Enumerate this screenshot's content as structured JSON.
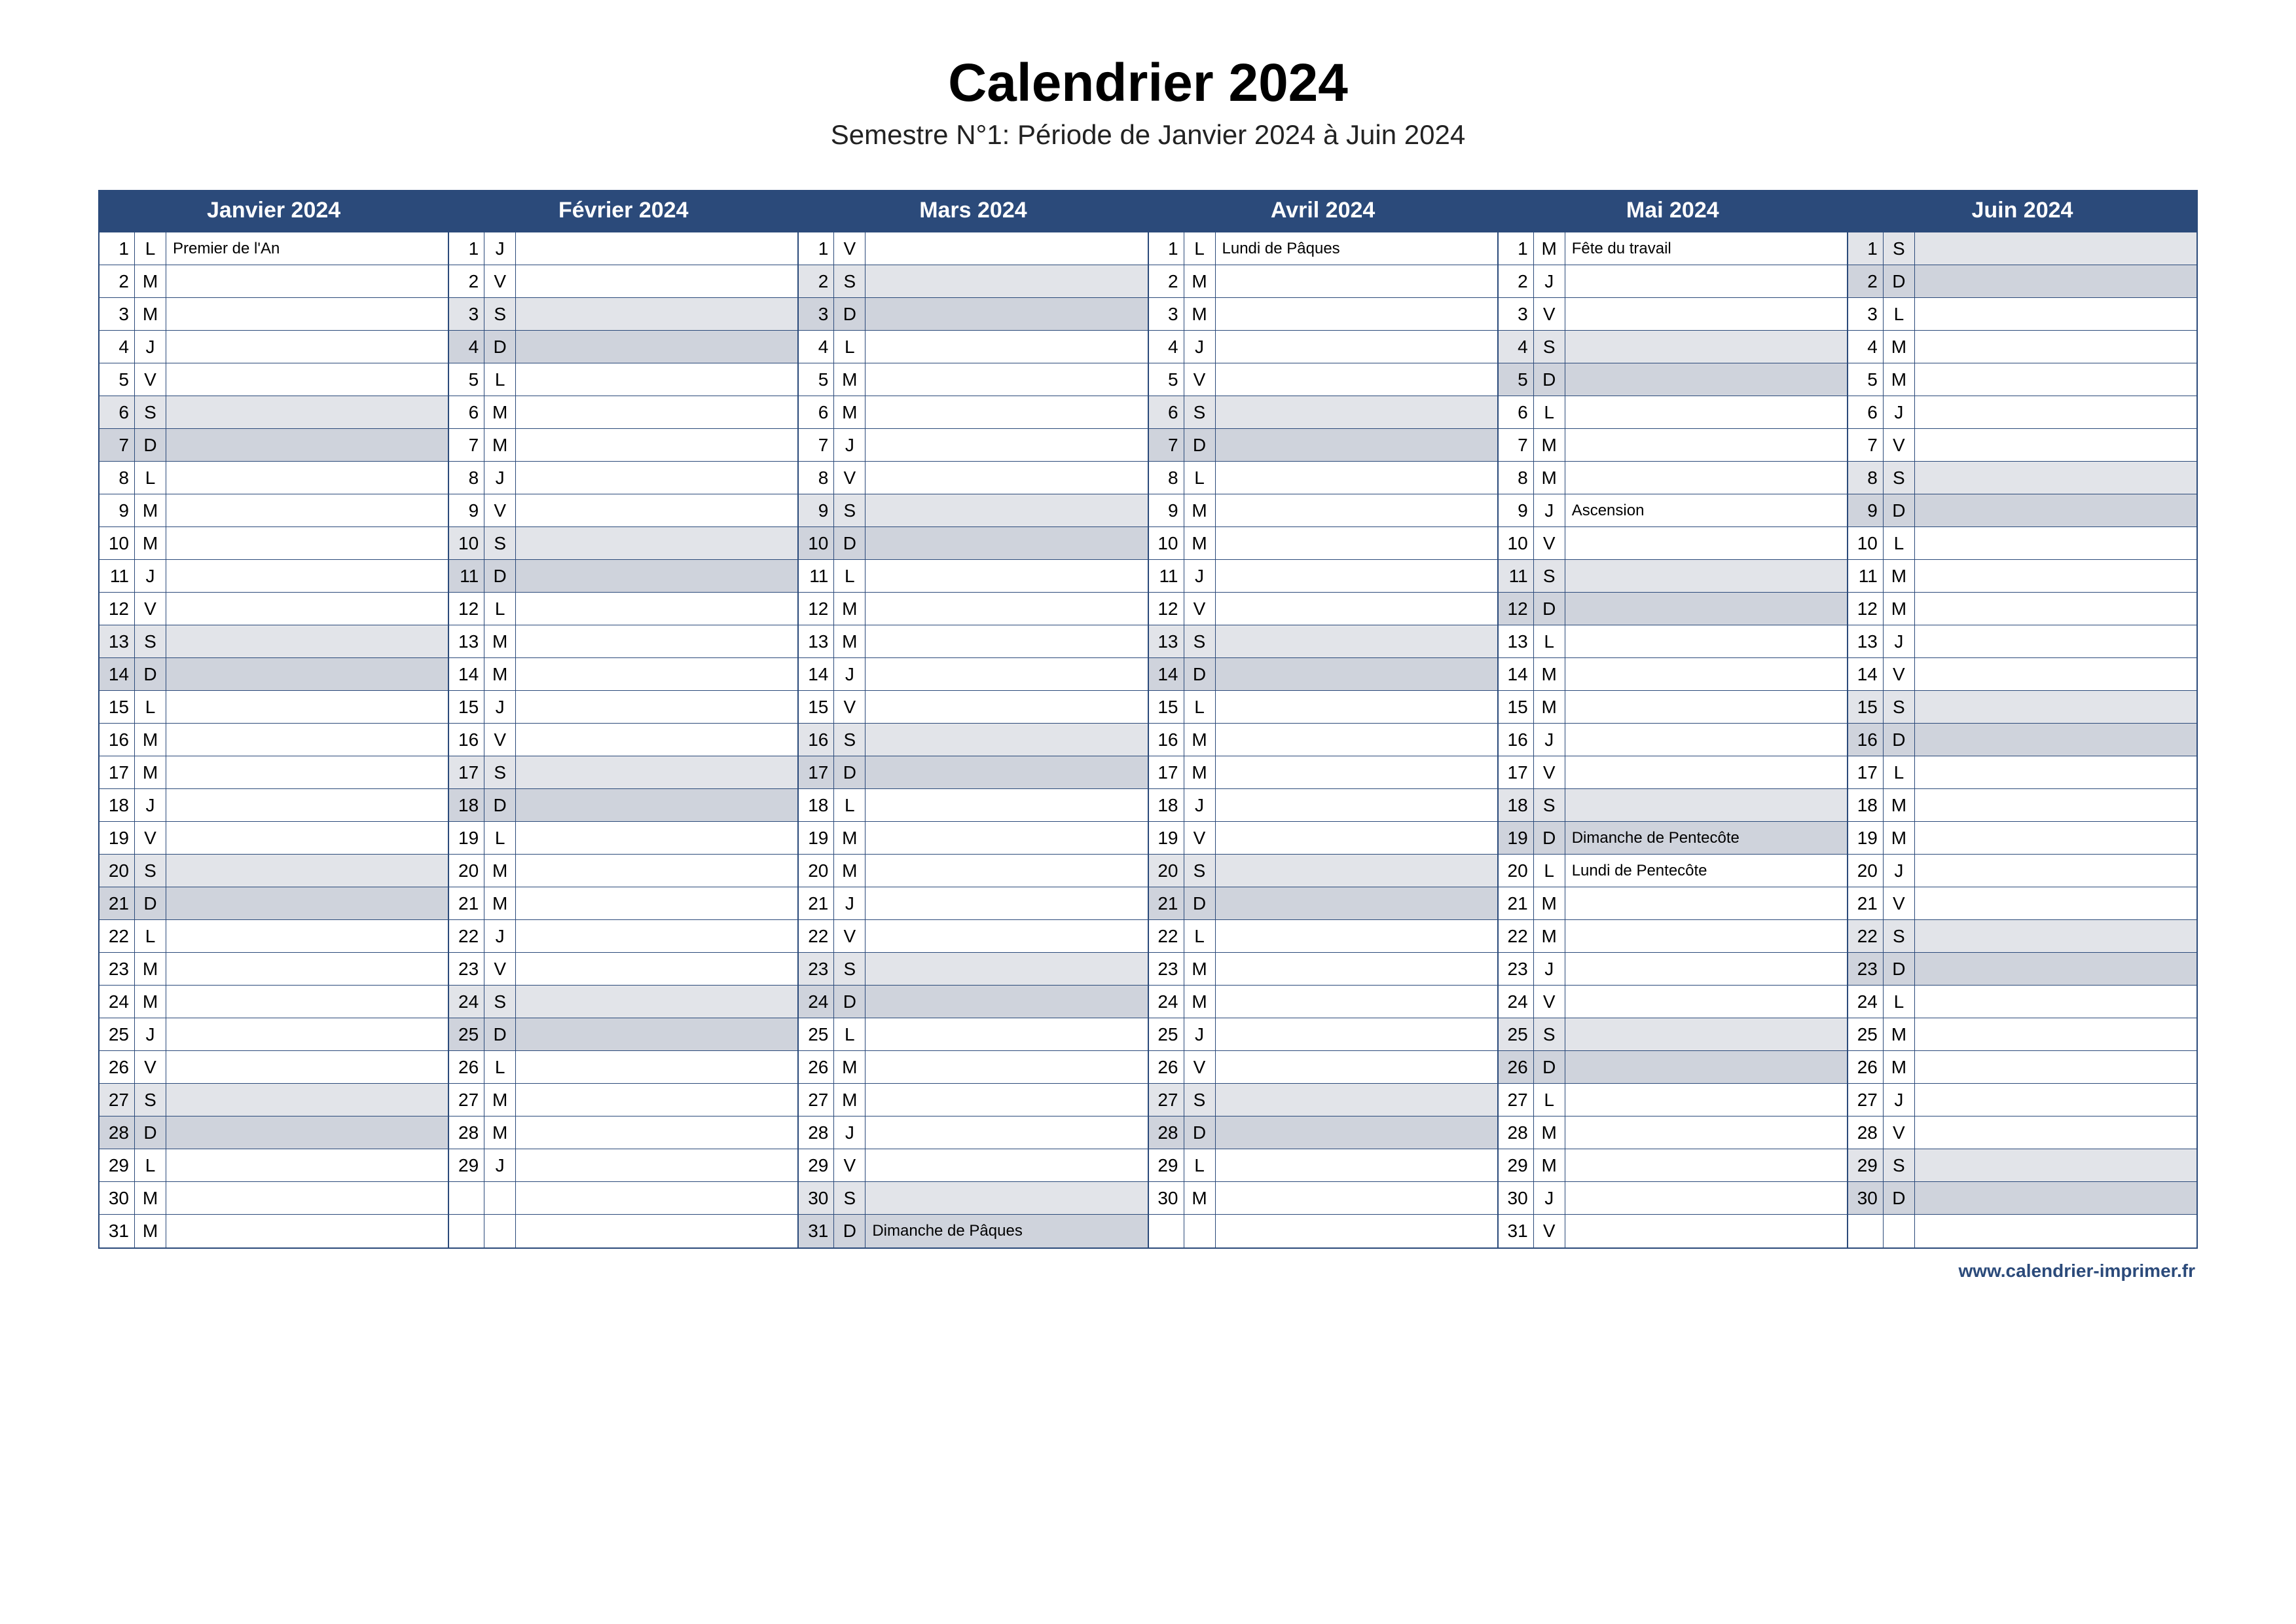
{
  "title": "Calendrier 2024",
  "subtitle": "Semestre N°1: Période de Janvier 2024 à Juin 2024",
  "footer_link": "www.calendrier-imprimer.fr",
  "months": [
    {
      "name": "Janvier 2024",
      "days": [
        {
          "n": 1,
          "d": "L",
          "note": "Premier de l'An"
        },
        {
          "n": 2,
          "d": "M"
        },
        {
          "n": 3,
          "d": "M"
        },
        {
          "n": 4,
          "d": "J"
        },
        {
          "n": 5,
          "d": "V"
        },
        {
          "n": 6,
          "d": "S",
          "w": true
        },
        {
          "n": 7,
          "d": "D",
          "s": true
        },
        {
          "n": 8,
          "d": "L"
        },
        {
          "n": 9,
          "d": "M"
        },
        {
          "n": 10,
          "d": "M"
        },
        {
          "n": 11,
          "d": "J"
        },
        {
          "n": 12,
          "d": "V"
        },
        {
          "n": 13,
          "d": "S",
          "w": true
        },
        {
          "n": 14,
          "d": "D",
          "s": true
        },
        {
          "n": 15,
          "d": "L"
        },
        {
          "n": 16,
          "d": "M"
        },
        {
          "n": 17,
          "d": "M"
        },
        {
          "n": 18,
          "d": "J"
        },
        {
          "n": 19,
          "d": "V"
        },
        {
          "n": 20,
          "d": "S",
          "w": true
        },
        {
          "n": 21,
          "d": "D",
          "s": true
        },
        {
          "n": 22,
          "d": "L"
        },
        {
          "n": 23,
          "d": "M"
        },
        {
          "n": 24,
          "d": "M"
        },
        {
          "n": 25,
          "d": "J"
        },
        {
          "n": 26,
          "d": "V"
        },
        {
          "n": 27,
          "d": "S",
          "w": true
        },
        {
          "n": 28,
          "d": "D",
          "s": true
        },
        {
          "n": 29,
          "d": "L"
        },
        {
          "n": 30,
          "d": "M"
        },
        {
          "n": 31,
          "d": "M"
        }
      ]
    },
    {
      "name": "Février 2024",
      "days": [
        {
          "n": 1,
          "d": "J"
        },
        {
          "n": 2,
          "d": "V"
        },
        {
          "n": 3,
          "d": "S",
          "w": true
        },
        {
          "n": 4,
          "d": "D",
          "s": true
        },
        {
          "n": 5,
          "d": "L"
        },
        {
          "n": 6,
          "d": "M"
        },
        {
          "n": 7,
          "d": "M"
        },
        {
          "n": 8,
          "d": "J"
        },
        {
          "n": 9,
          "d": "V"
        },
        {
          "n": 10,
          "d": "S",
          "w": true
        },
        {
          "n": 11,
          "d": "D",
          "s": true
        },
        {
          "n": 12,
          "d": "L"
        },
        {
          "n": 13,
          "d": "M"
        },
        {
          "n": 14,
          "d": "M"
        },
        {
          "n": 15,
          "d": "J"
        },
        {
          "n": 16,
          "d": "V"
        },
        {
          "n": 17,
          "d": "S",
          "w": true
        },
        {
          "n": 18,
          "d": "D",
          "s": true
        },
        {
          "n": 19,
          "d": "L"
        },
        {
          "n": 20,
          "d": "M"
        },
        {
          "n": 21,
          "d": "M"
        },
        {
          "n": 22,
          "d": "J"
        },
        {
          "n": 23,
          "d": "V"
        },
        {
          "n": 24,
          "d": "S",
          "w": true
        },
        {
          "n": 25,
          "d": "D",
          "s": true
        },
        {
          "n": 26,
          "d": "L"
        },
        {
          "n": 27,
          "d": "M"
        },
        {
          "n": 28,
          "d": "M"
        },
        {
          "n": 29,
          "d": "J"
        },
        {
          "empty": true
        },
        {
          "empty": true
        }
      ]
    },
    {
      "name": "Mars 2024",
      "days": [
        {
          "n": 1,
          "d": "V"
        },
        {
          "n": 2,
          "d": "S",
          "w": true
        },
        {
          "n": 3,
          "d": "D",
          "s": true
        },
        {
          "n": 4,
          "d": "L"
        },
        {
          "n": 5,
          "d": "M"
        },
        {
          "n": 6,
          "d": "M"
        },
        {
          "n": 7,
          "d": "J"
        },
        {
          "n": 8,
          "d": "V"
        },
        {
          "n": 9,
          "d": "S",
          "w": true
        },
        {
          "n": 10,
          "d": "D",
          "s": true
        },
        {
          "n": 11,
          "d": "L"
        },
        {
          "n": 12,
          "d": "M"
        },
        {
          "n": 13,
          "d": "M"
        },
        {
          "n": 14,
          "d": "J"
        },
        {
          "n": 15,
          "d": "V"
        },
        {
          "n": 16,
          "d": "S",
          "w": true
        },
        {
          "n": 17,
          "d": "D",
          "s": true
        },
        {
          "n": 18,
          "d": "L"
        },
        {
          "n": 19,
          "d": "M"
        },
        {
          "n": 20,
          "d": "M"
        },
        {
          "n": 21,
          "d": "J"
        },
        {
          "n": 22,
          "d": "V"
        },
        {
          "n": 23,
          "d": "S",
          "w": true
        },
        {
          "n": 24,
          "d": "D",
          "s": true
        },
        {
          "n": 25,
          "d": "L"
        },
        {
          "n": 26,
          "d": "M"
        },
        {
          "n": 27,
          "d": "M"
        },
        {
          "n": 28,
          "d": "J"
        },
        {
          "n": 29,
          "d": "V"
        },
        {
          "n": 30,
          "d": "S",
          "w": true
        },
        {
          "n": 31,
          "d": "D",
          "s": true,
          "note": "Dimanche de Pâques"
        }
      ]
    },
    {
      "name": "Avril 2024",
      "days": [
        {
          "n": 1,
          "d": "L",
          "note": "Lundi de Pâques"
        },
        {
          "n": 2,
          "d": "M"
        },
        {
          "n": 3,
          "d": "M"
        },
        {
          "n": 4,
          "d": "J"
        },
        {
          "n": 5,
          "d": "V"
        },
        {
          "n": 6,
          "d": "S",
          "w": true
        },
        {
          "n": 7,
          "d": "D",
          "s": true
        },
        {
          "n": 8,
          "d": "L"
        },
        {
          "n": 9,
          "d": "M"
        },
        {
          "n": 10,
          "d": "M"
        },
        {
          "n": 11,
          "d": "J"
        },
        {
          "n": 12,
          "d": "V"
        },
        {
          "n": 13,
          "d": "S",
          "w": true
        },
        {
          "n": 14,
          "d": "D",
          "s": true
        },
        {
          "n": 15,
          "d": "L"
        },
        {
          "n": 16,
          "d": "M"
        },
        {
          "n": 17,
          "d": "M"
        },
        {
          "n": 18,
          "d": "J"
        },
        {
          "n": 19,
          "d": "V"
        },
        {
          "n": 20,
          "d": "S",
          "w": true
        },
        {
          "n": 21,
          "d": "D",
          "s": true
        },
        {
          "n": 22,
          "d": "L"
        },
        {
          "n": 23,
          "d": "M"
        },
        {
          "n": 24,
          "d": "M"
        },
        {
          "n": 25,
          "d": "J"
        },
        {
          "n": 26,
          "d": "V"
        },
        {
          "n": 27,
          "d": "S",
          "w": true
        },
        {
          "n": 28,
          "d": "D",
          "s": true
        },
        {
          "n": 29,
          "d": "L"
        },
        {
          "n": 30,
          "d": "M"
        },
        {
          "empty": true
        }
      ]
    },
    {
      "name": "Mai 2024",
      "days": [
        {
          "n": 1,
          "d": "M",
          "note": "Fête du travail"
        },
        {
          "n": 2,
          "d": "J"
        },
        {
          "n": 3,
          "d": "V"
        },
        {
          "n": 4,
          "d": "S",
          "w": true
        },
        {
          "n": 5,
          "d": "D",
          "s": true
        },
        {
          "n": 6,
          "d": "L"
        },
        {
          "n": 7,
          "d": "M"
        },
        {
          "n": 8,
          "d": "M"
        },
        {
          "n": 9,
          "d": "J",
          "note": "Ascension"
        },
        {
          "n": 10,
          "d": "V"
        },
        {
          "n": 11,
          "d": "S",
          "w": true
        },
        {
          "n": 12,
          "d": "D",
          "s": true
        },
        {
          "n": 13,
          "d": "L"
        },
        {
          "n": 14,
          "d": "M"
        },
        {
          "n": 15,
          "d": "M"
        },
        {
          "n": 16,
          "d": "J"
        },
        {
          "n": 17,
          "d": "V"
        },
        {
          "n": 18,
          "d": "S",
          "w": true
        },
        {
          "n": 19,
          "d": "D",
          "s": true,
          "note": "Dimanche de Pentecôte"
        },
        {
          "n": 20,
          "d": "L",
          "note": "Lundi de Pentecôte"
        },
        {
          "n": 21,
          "d": "M"
        },
        {
          "n": 22,
          "d": "M"
        },
        {
          "n": 23,
          "d": "J"
        },
        {
          "n": 24,
          "d": "V"
        },
        {
          "n": 25,
          "d": "S",
          "w": true
        },
        {
          "n": 26,
          "d": "D",
          "s": true
        },
        {
          "n": 27,
          "d": "L"
        },
        {
          "n": 28,
          "d": "M"
        },
        {
          "n": 29,
          "d": "M"
        },
        {
          "n": 30,
          "d": "J"
        },
        {
          "n": 31,
          "d": "V"
        }
      ]
    },
    {
      "name": "Juin 2024",
      "days": [
        {
          "n": 1,
          "d": "S",
          "w": true
        },
        {
          "n": 2,
          "d": "D",
          "s": true
        },
        {
          "n": 3,
          "d": "L"
        },
        {
          "n": 4,
          "d": "M"
        },
        {
          "n": 5,
          "d": "M"
        },
        {
          "n": 6,
          "d": "J"
        },
        {
          "n": 7,
          "d": "V"
        },
        {
          "n": 8,
          "d": "S",
          "w": true
        },
        {
          "n": 9,
          "d": "D",
          "s": true
        },
        {
          "n": 10,
          "d": "L"
        },
        {
          "n": 11,
          "d": "M"
        },
        {
          "n": 12,
          "d": "M"
        },
        {
          "n": 13,
          "d": "J"
        },
        {
          "n": 14,
          "d": "V"
        },
        {
          "n": 15,
          "d": "S",
          "w": true
        },
        {
          "n": 16,
          "d": "D",
          "s": true
        },
        {
          "n": 17,
          "d": "L"
        },
        {
          "n": 18,
          "d": "M"
        },
        {
          "n": 19,
          "d": "M"
        },
        {
          "n": 20,
          "d": "J"
        },
        {
          "n": 21,
          "d": "V"
        },
        {
          "n": 22,
          "d": "S",
          "w": true
        },
        {
          "n": 23,
          "d": "D",
          "s": true
        },
        {
          "n": 24,
          "d": "L"
        },
        {
          "n": 25,
          "d": "M"
        },
        {
          "n": 26,
          "d": "M"
        },
        {
          "n": 27,
          "d": "J"
        },
        {
          "n": 28,
          "d": "V"
        },
        {
          "n": 29,
          "d": "S",
          "w": true
        },
        {
          "n": 30,
          "d": "D",
          "s": true
        },
        {
          "empty": true
        }
      ]
    }
  ]
}
